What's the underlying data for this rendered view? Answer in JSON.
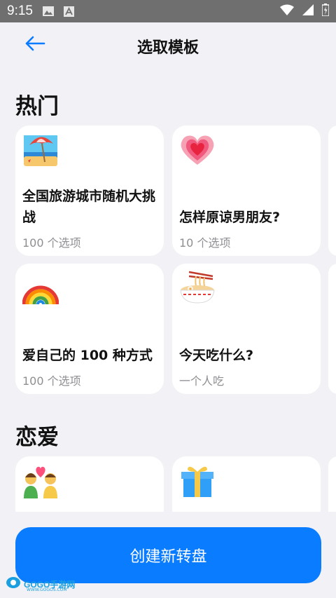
{
  "status_bar": {
    "time": "9:15",
    "icons": [
      "image-icon",
      "a-box-icon",
      "wifi-icon",
      "signal-icon",
      "battery-icon"
    ]
  },
  "header": {
    "title": "选取模板",
    "back_icon": "back-arrow-icon"
  },
  "sections": [
    {
      "title": "热门",
      "cards": [
        {
          "name": "全国旅游城市随机大挑战",
          "sub": "100 个选项",
          "emoji": "beach-umbrella-icon"
        },
        {
          "name": "怎样原谅男朋友?",
          "sub": "10 个选项",
          "emoji": "heart-icon"
        },
        {
          "name": "爱自己的 100 种方式",
          "sub": "100 个选项",
          "emoji": "rainbow-icon"
        },
        {
          "name": "今天吃什么?",
          "sub": "一个人吃",
          "emoji": "noodle-bowl-icon"
        }
      ]
    },
    {
      "title": "恋爱",
      "cards": [
        {
          "name": "",
          "sub": "",
          "emoji": "couple-heart-icon"
        },
        {
          "name": "",
          "sub": "",
          "emoji": "gift-icon"
        }
      ]
    }
  ],
  "create_button": {
    "label": "创建新转盘"
  },
  "watermark": {
    "text": "GOGO手游网",
    "url": "WWW.GOGOS.COM"
  },
  "colors": {
    "accent": "#0a7cff",
    "background": "#f2f2f6",
    "card": "#ffffff",
    "statusbar": "#6f6f6f"
  }
}
